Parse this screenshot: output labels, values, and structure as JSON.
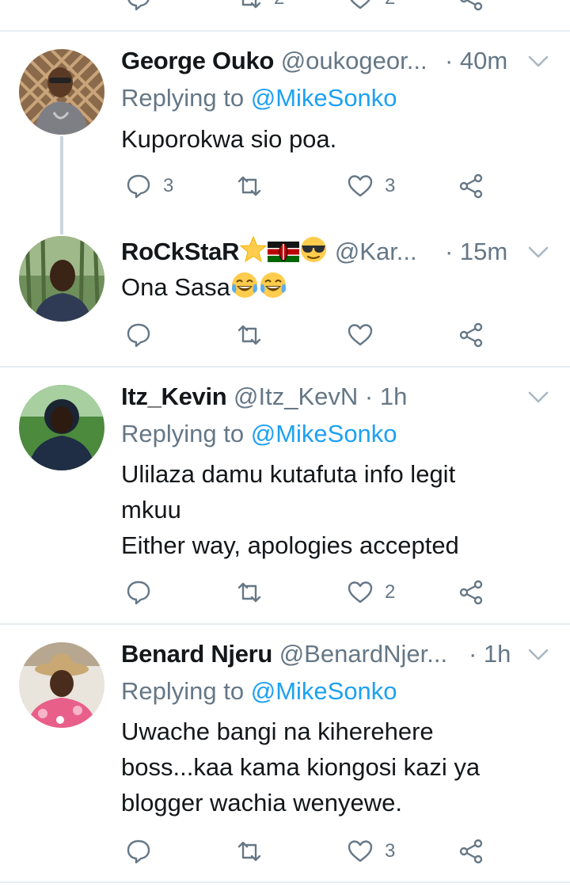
{
  "colors": {
    "link": "#1da1f2",
    "muted": "#657786",
    "text": "#14171a",
    "divider": "#e6ecf0"
  },
  "top_actions": {
    "retweet_count": "2",
    "like_count": "2"
  },
  "tweets": [
    {
      "name": "George Ouko",
      "handle": "@oukogeor...",
      "time": "· 40m",
      "replying_label": "Replying to",
      "replying_to": "@MikeSonko",
      "text": "Kuporokwa sio poa.",
      "reply_count": "3",
      "retweet_count": "",
      "like_count": "3"
    },
    {
      "name": "RoCkStaR",
      "name_emojis": [
        "star-emoji",
        "kenya-flag-emoji",
        "sunglasses-emoji"
      ],
      "handle": "@Kar...",
      "time": "· 15m",
      "text": "Ona Sasa",
      "text_emojis": [
        "tears-of-joy-emoji",
        "tears-of-joy-emoji"
      ],
      "reply_count": "",
      "retweet_count": "",
      "like_count": ""
    },
    {
      "name": "Itz_Kevin",
      "handle": "@Itz_KevN",
      "time": "· 1h",
      "replying_label": "Replying to",
      "replying_to": "@MikeSonko",
      "text_lines": [
        "Ulilaza damu kutafuta info legit",
        "mkuu",
        "Either way, apologies accepted"
      ],
      "reply_count": "",
      "retweet_count": "",
      "like_count": "2"
    },
    {
      "name": "Benard Njeru",
      "handle": "@BenardNjer...",
      "time": "· 1h",
      "replying_label": "Replying to",
      "replying_to": "@MikeSonko",
      "text_lines": [
        "Uwache bangi na kiherehere",
        "boss...kaa kama kiongosi kazi ya",
        "blogger wachia wenyewe."
      ],
      "reply_count": "",
      "retweet_count": "",
      "like_count": "3"
    }
  ]
}
